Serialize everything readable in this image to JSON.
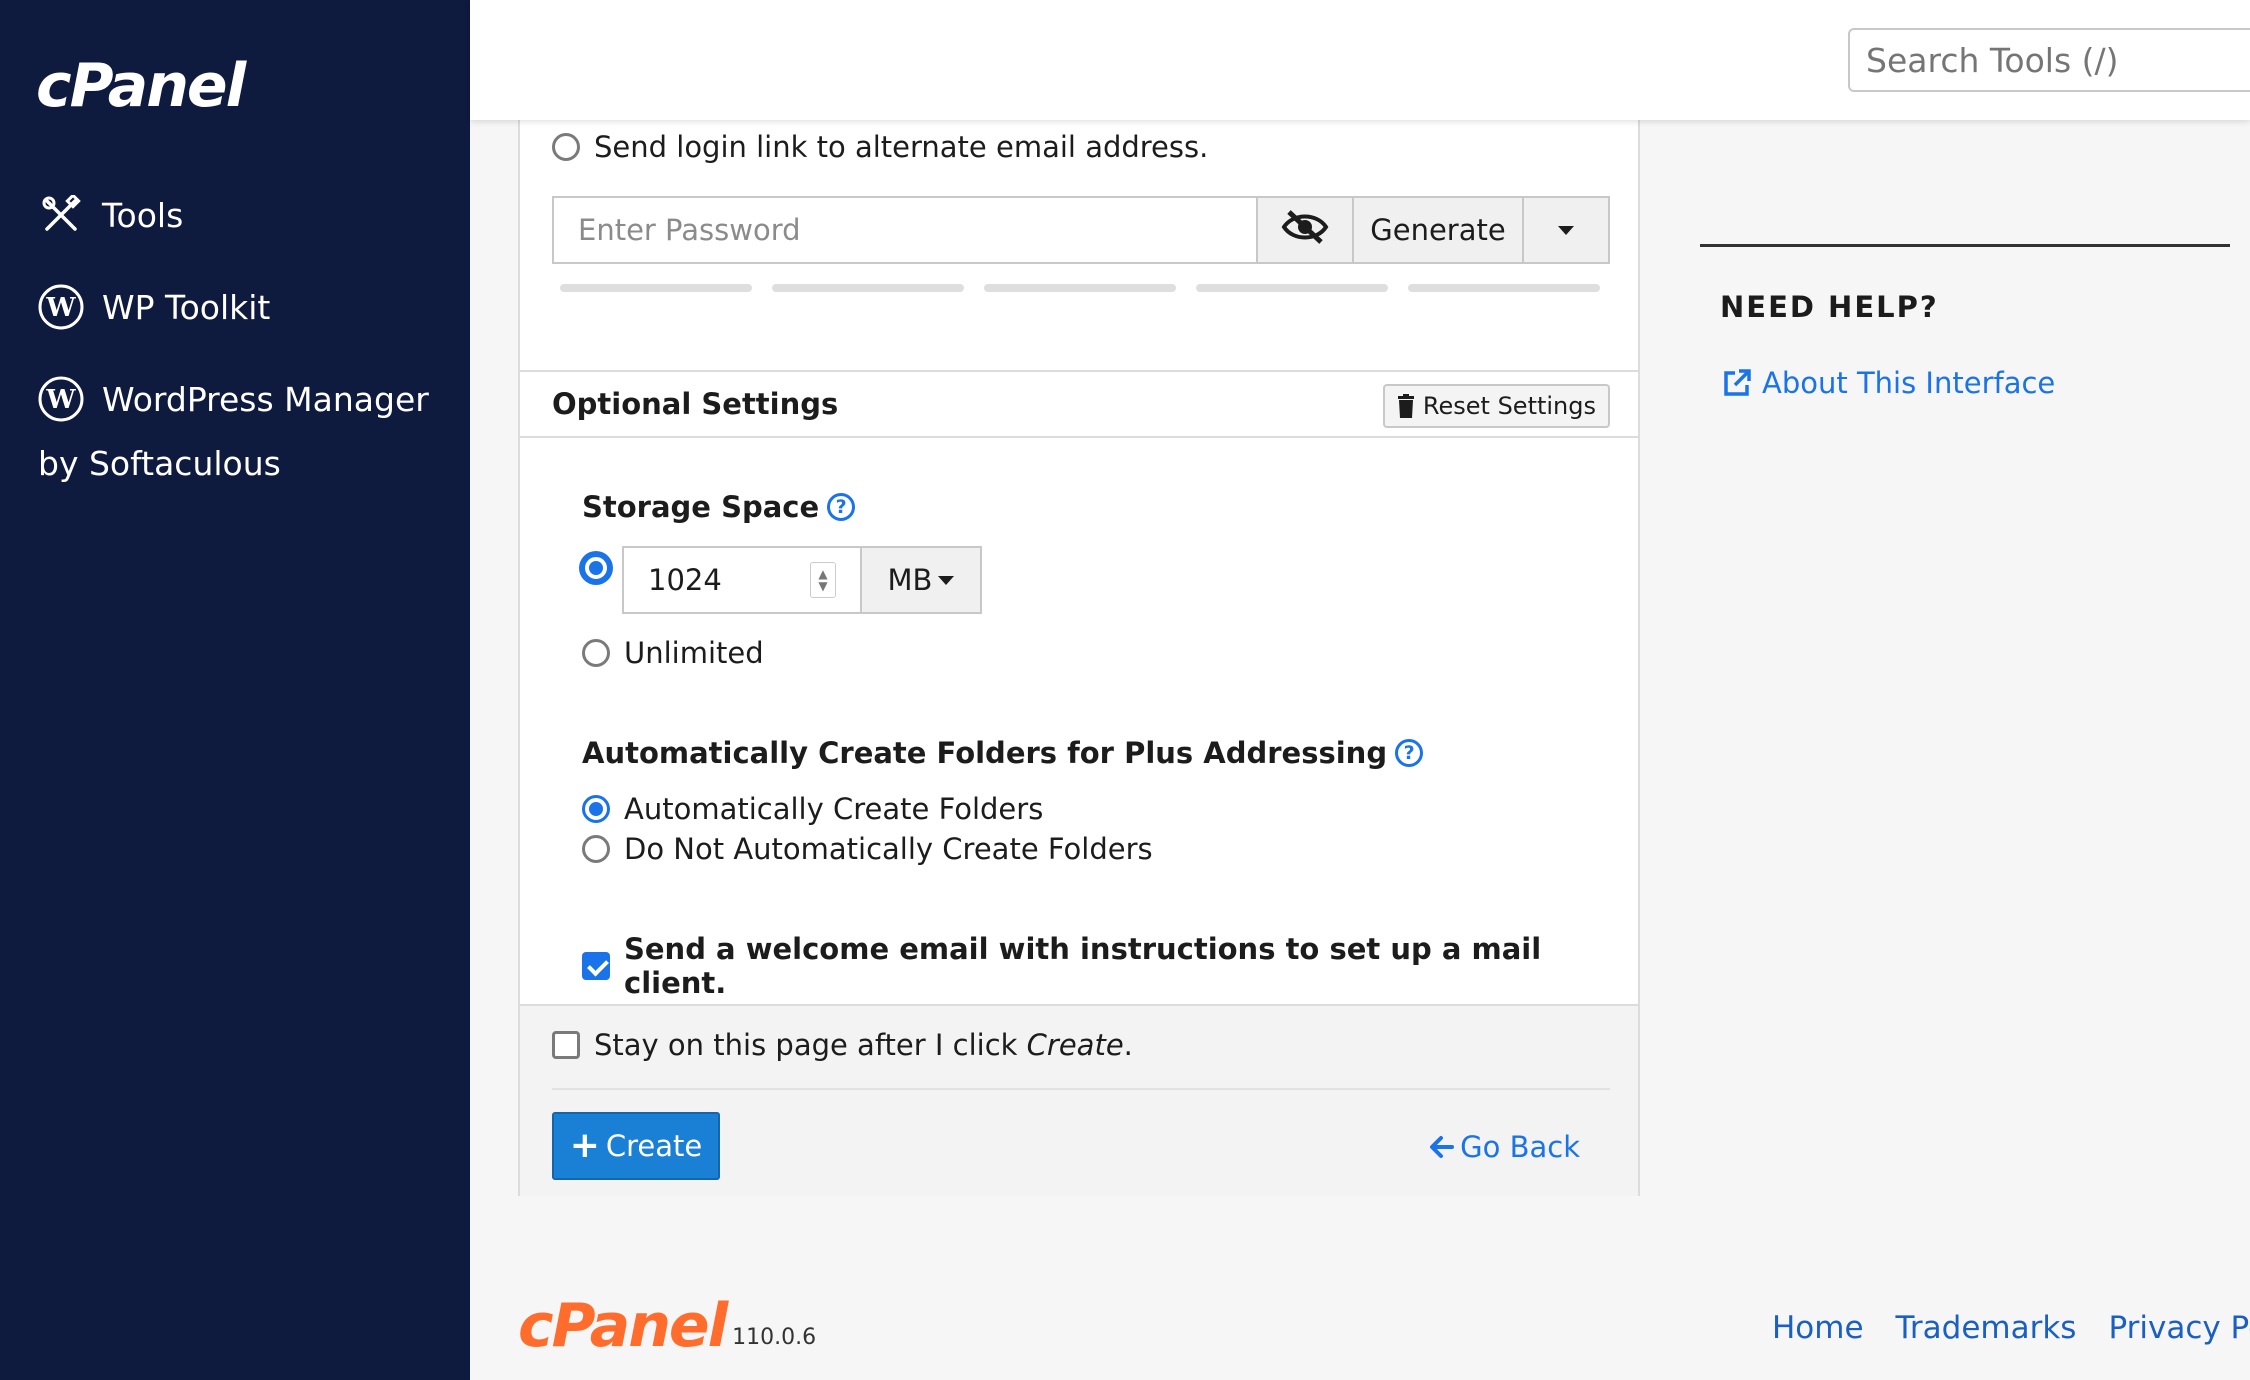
{
  "sidebar": {
    "brand": "cPanel",
    "items": [
      {
        "label": "Tools",
        "icon": "tools-icon"
      },
      {
        "label": "WP Toolkit",
        "icon": "wordpress-icon"
      },
      {
        "label": "WordPress Manager",
        "icon": "wordpress-icon"
      }
    ],
    "sub_label": "by Softaculous"
  },
  "header": {
    "search_placeholder": "Search Tools (/)"
  },
  "form": {
    "login_link_option": "Send login link to alternate email address.",
    "password_placeholder": "Enter Password",
    "generate_label": "Generate",
    "optional_settings_title": "Optional Settings",
    "reset_settings_label": "Reset Settings",
    "storage": {
      "label": "Storage Space",
      "value": "1024",
      "unit": "MB",
      "unlimited_label": "Unlimited"
    },
    "plus_addressing": {
      "label": "Automatically Create Folders for Plus Addressing",
      "option_auto": "Automatically Create Folders",
      "option_none": "Do Not Automatically Create Folders"
    },
    "welcome_email_label": "Send a welcome email with instructions to set up a mail client.",
    "stay_on_page_prefix": "Stay on this page after I click ",
    "stay_on_page_emph": "Create",
    "stay_on_page_suffix": ".",
    "create_label": "Create",
    "go_back_label": "Go Back"
  },
  "help": {
    "title": "NEED HELP?",
    "link": "About This Interface"
  },
  "footer": {
    "brand": "cPanel",
    "version": "110.0.6",
    "links": [
      "Home",
      "Trademarks",
      "Privacy Pol"
    ]
  },
  "colors": {
    "sidebar_bg": "#0e1a3e",
    "accent": "#1a73e8",
    "create_button": "#1a80d6",
    "footer_brand": "#ff6c2c"
  }
}
